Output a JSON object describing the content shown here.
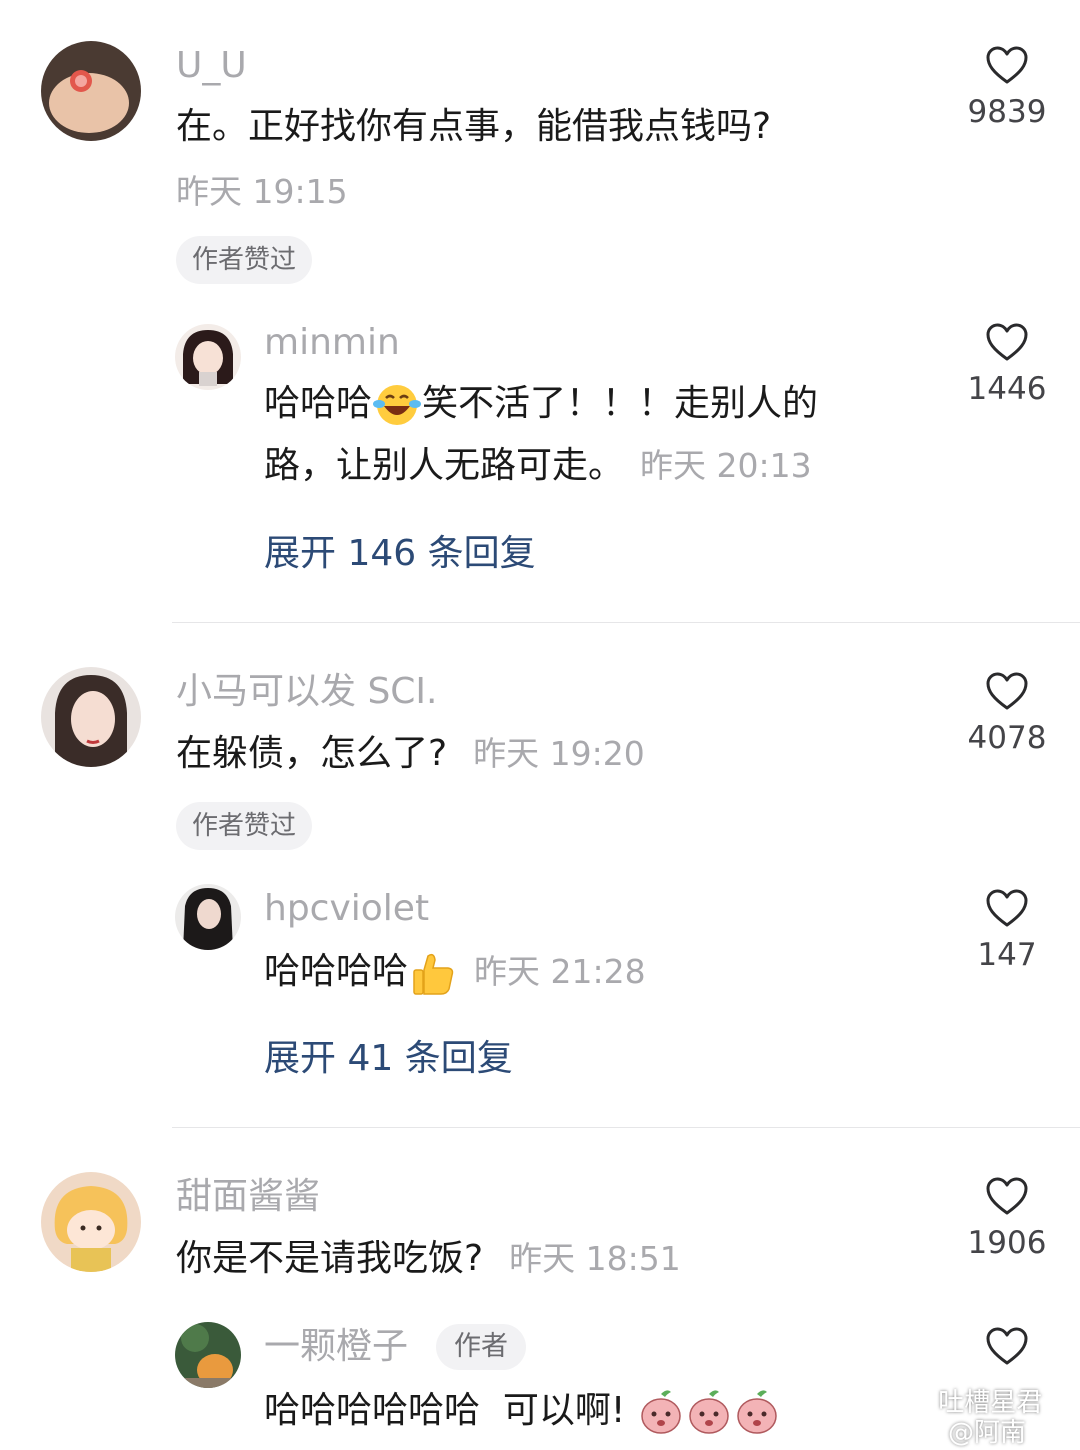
{
  "comments": [
    {
      "user": "U_U",
      "text": "在。正好找你有点事，能借我点钱吗?",
      "time": "昨天 19:15",
      "badge": "作者赞过",
      "likes": "9839",
      "reply": {
        "user": "minmin",
        "line1_a": "哈哈哈",
        "line1_b": "笑不活了！！！走别人的",
        "line2": "路，让别人无路可走。",
        "time": "昨天 20:13",
        "likes": "1446"
      },
      "expand": "展开 146 条回复"
    },
    {
      "user": "小马可以发 SCI.",
      "text": "在躲债，怎么了?",
      "time": "昨天 19:20",
      "badge": "作者赞过",
      "likes": "4078",
      "reply": {
        "user": "hpcviolet",
        "text": "哈哈哈哈",
        "time": "昨天 21:28",
        "likes": "147"
      },
      "expand": "展开 41 条回复"
    },
    {
      "user": "甜面酱酱",
      "text": "你是不是请我吃饭?",
      "time": "昨天 18:51",
      "likes": "1906",
      "reply": {
        "user": "一颗橙子",
        "author_tag": "作者",
        "text": "哈哈哈哈哈哈  可以啊!"
      }
    }
  ],
  "icons": {
    "heart": "heart-outline-icon",
    "laugh": "laughing-tears-emoji",
    "thumbs": "thumbs-up-emoji",
    "peach": "peach-face-emoji"
  },
  "watermark": {
    "line1": "吐槽星君",
    "line2": "@阿南"
  },
  "colors": {
    "username": "#a9a9ad",
    "text": "#1a1a1a",
    "link": "#2c4a76",
    "badge_bg": "#f2f2f4"
  }
}
